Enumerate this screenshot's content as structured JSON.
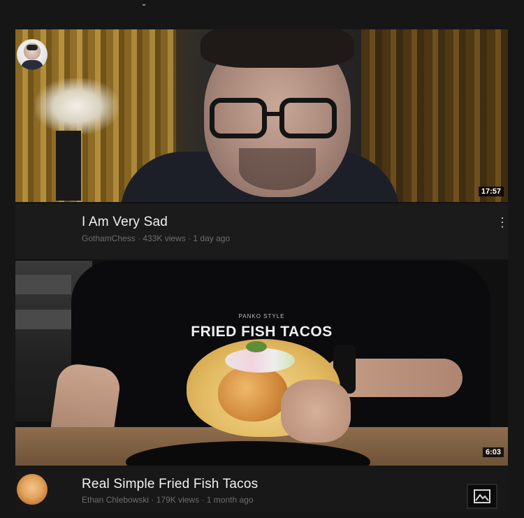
{
  "videos": [
    {
      "title": "I Am Very Sad",
      "channel": "GothamChess",
      "views": "433K views",
      "age": "1 day ago",
      "duration": "17:57",
      "menu_glyph": "⋮"
    },
    {
      "title": "Real Simple Fried Fish Tacos",
      "channel": "Ethan Chlebowski",
      "views": "179K views",
      "age": "1 month ago",
      "duration": "6:03",
      "overlay_small": "PANKO STYLE",
      "overlay_big": "FRIED FISH TACOS"
    }
  ],
  "separator": " · ",
  "icons": {
    "menu": "more-vert-icon",
    "image": "image-icon"
  }
}
